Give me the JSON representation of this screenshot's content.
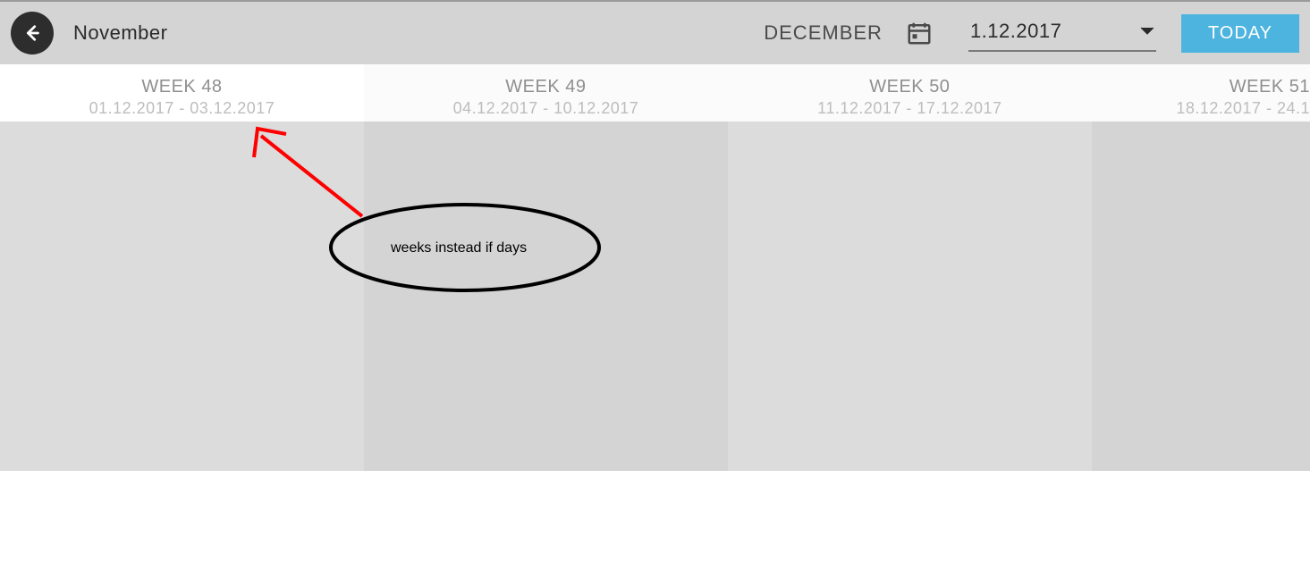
{
  "topbar": {
    "prev_month_label": "November",
    "current_month_title": "DECEMBER",
    "date_value": "1.12.2017",
    "today_button": "TODAY"
  },
  "weeks": [
    {
      "title": "WEEK 48",
      "range": "01.12.2017 - 03.12.2017",
      "active": true
    },
    {
      "title": "WEEK 49",
      "range": "04.12.2017 - 10.12.2017",
      "active": false
    },
    {
      "title": "WEEK 50",
      "range": "11.12.2017 - 17.12.2017",
      "active": false
    },
    {
      "title": "WEEK 51",
      "range": "18.12.2017 - 24.1",
      "active": false
    }
  ],
  "annotation": {
    "text": "weeks instead if days"
  },
  "colors": {
    "accent": "#4db4df",
    "arrow": "#ff0000"
  }
}
